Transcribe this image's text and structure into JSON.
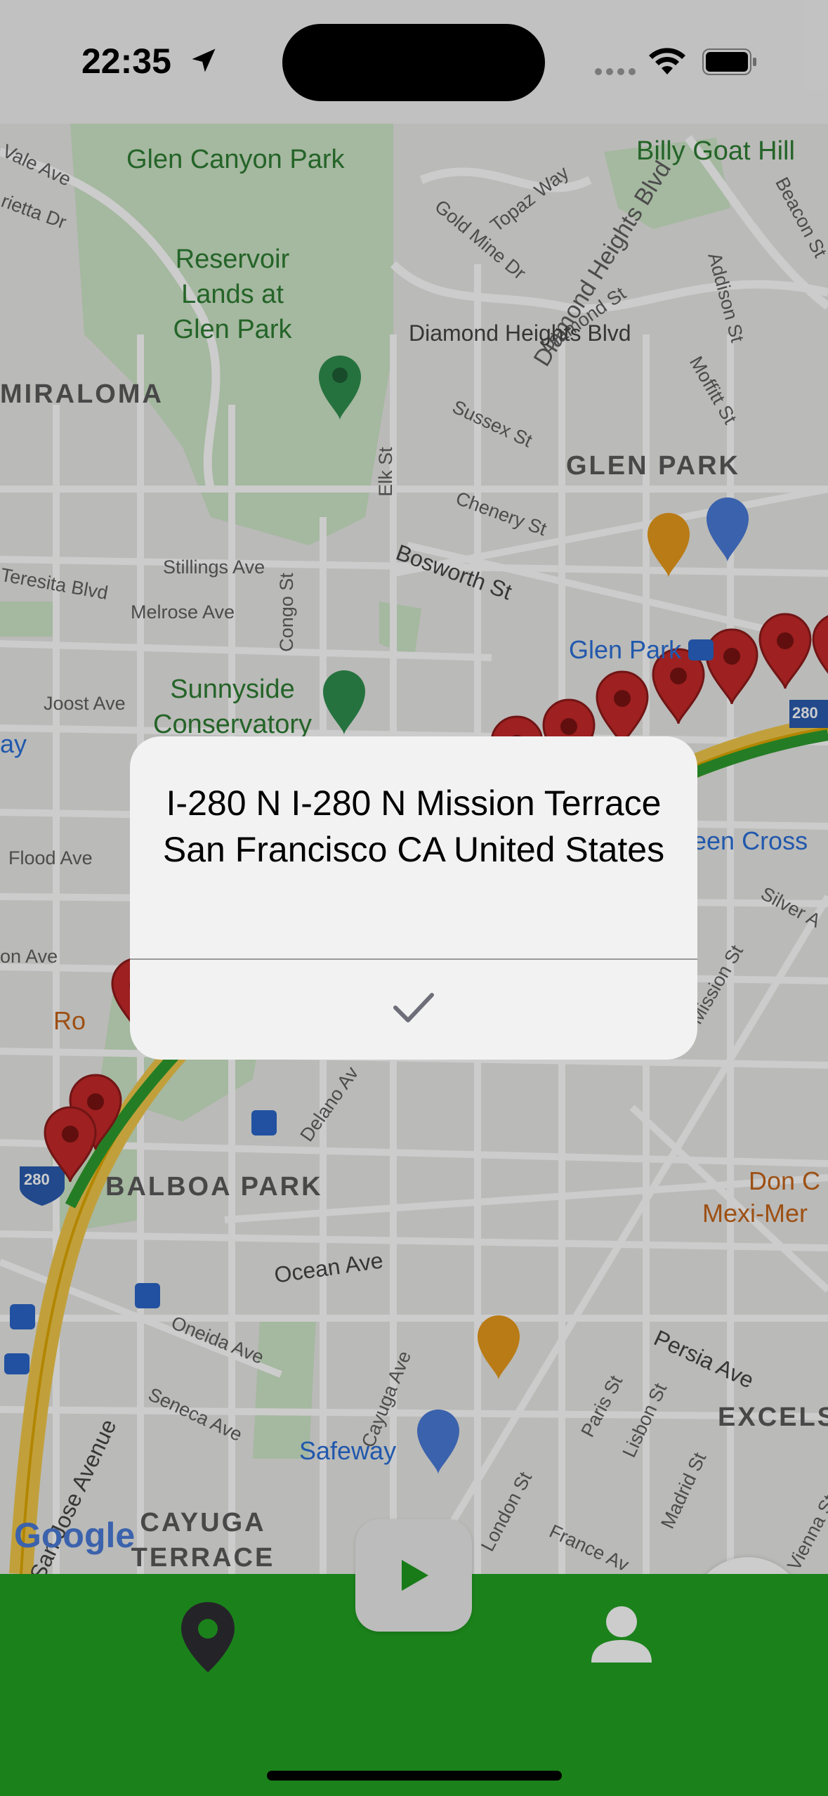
{
  "status_bar": {
    "time": "22:35",
    "location_icon": "location-arrow-icon",
    "wifi_icon": "wifi-icon",
    "battery_icon": "battery-icon"
  },
  "map": {
    "park_labels": [
      "Glen Canyon Park",
      "Reservoir Lands at Glen Park",
      "Sunnyside Conservatory"
    ],
    "neighborhoods": [
      "MIRALOMA",
      "GLEN PARK",
      "BALBOA PARK",
      "CAYUGA TERRACE",
      "EXCELS"
    ],
    "hill": "Billy Goat Hill",
    "streets": [
      "Vale Ave",
      "rietta Dr",
      "Topaz Way",
      "Gold Mine Dr",
      "Diamond Heights Blvd",
      "Diamond St",
      "Beacon St",
      "Addison St",
      "Moffitt St",
      "Diamond Heights Blvd",
      "Sussex St",
      "Elk St",
      "Chenery St",
      "Bosworth St",
      "Stillings Ave",
      "Teresita Blvd",
      "Melrose Ave",
      "Congo St",
      "Joost Ave",
      "Flood Ave",
      "on Ave",
      "Silver A",
      "Mission St",
      "Delano Av",
      "Ocean Ave",
      "Oneida Ave",
      "Seneca Ave",
      "Cayuga Ave",
      "San Jose Avenue",
      "Persia Ave",
      "Paris St",
      "Lisbon St",
      "Madrid St",
      "London St",
      "France Av",
      "Vienna St"
    ],
    "pois": {
      "glen_park_station": "Glen Park",
      "green_cross": "een Cross",
      "safeway": "Safeway",
      "don_c": "Don C",
      "mexi_mer": "Mexi-Mer",
      "way": "ay",
      "ro": "Ro"
    },
    "highway_shield": "280",
    "attribution": "Google"
  },
  "alert": {
    "title": "I-280 N I-280 N Mission Terrace San Francisco CA United States",
    "confirm_icon": "checkmark-icon"
  },
  "tab_bar": {
    "map_tab_icon": "map-pin-icon",
    "play_icon": "play-icon",
    "profile_tab_icon": "person-icon",
    "background": "#22a322"
  },
  "colors": {
    "marker_red": "#c62828",
    "route_green": "#2e9d2e",
    "highway_yellow": "#f2c94c",
    "park_green": "#cfe6c8"
  }
}
